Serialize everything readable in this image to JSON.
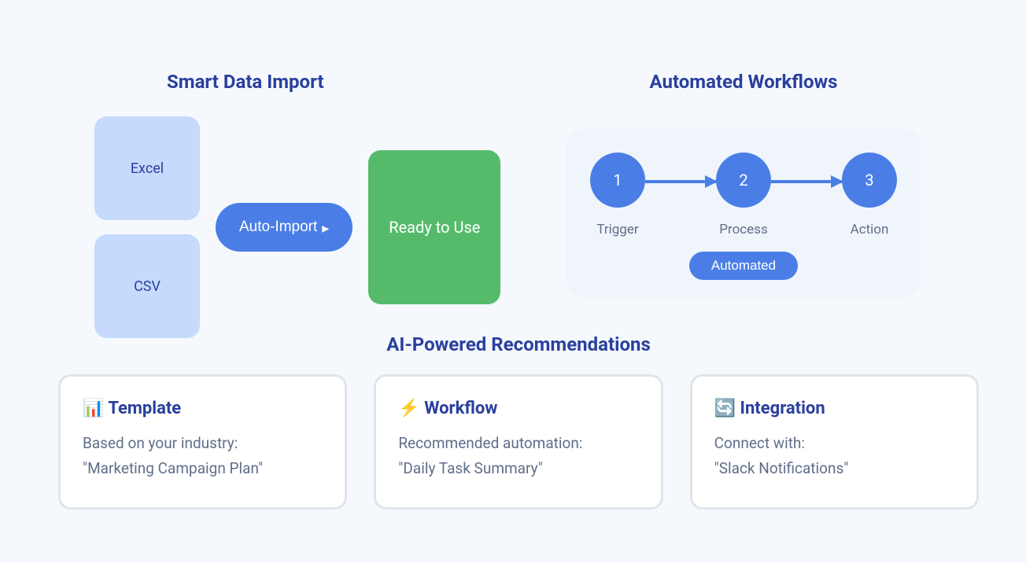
{
  "smartImport": {
    "title": "Smart Data Import",
    "file1": "Excel",
    "file2": "CSV",
    "button": "Auto-Import",
    "ready": "Ready to Use"
  },
  "workflows": {
    "title": "Automated Workflows",
    "step1": {
      "num": "1",
      "label": "Trigger"
    },
    "step2": {
      "num": "2",
      "label": "Process"
    },
    "step3": {
      "num": "3",
      "label": "Action"
    },
    "automated": "Automated"
  },
  "recommendations": {
    "title": "AI-Powered Recommendations",
    "cards": [
      {
        "icon": "📊",
        "heading": "Template",
        "line1": "Based on your industry:",
        "line2": "\"Marketing Campaign Plan\""
      },
      {
        "icon": "⚡",
        "heading": "Workflow",
        "line1": "Recommended automation:",
        "line2": "\"Daily Task Summary\""
      },
      {
        "icon": "🔄",
        "heading": "Integration",
        "line1": "Connect with:",
        "line2": "\"Slack Notifications\""
      }
    ]
  }
}
